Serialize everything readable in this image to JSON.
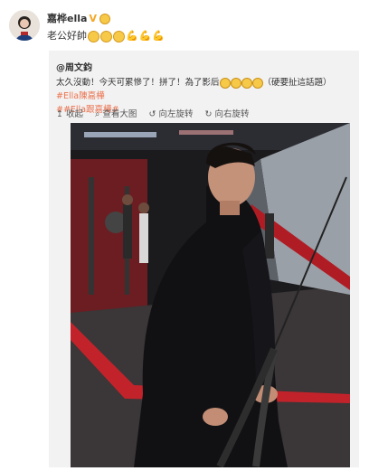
{
  "post": {
    "author": "嘉桦ella",
    "verified_badge": "V",
    "text": "老公好帥"
  },
  "repost": {
    "author": "@周文鈞",
    "text_main": "太久沒動！今天可累慘了！拼了！為了影后",
    "text_tail": "（硬要扯這話題）",
    "hashtag_1": "#Ella陳嘉樺",
    "hashtag_2": "##Ella跟嘉樺#",
    "toolbar": {
      "collect": "收起",
      "view_large": "查看大图",
      "rotate_left": "向左旋转",
      "rotate_right": "向右旋转"
    }
  },
  "colors": {
    "link": "#eb7350",
    "badge": "#f5a623",
    "repost_bg": "#f2f2f2"
  },
  "icons": [
    "avatar",
    "verified-icon",
    "grin-emoji-icon",
    "flexed-arm-icon",
    "collapse-icon",
    "search-icon",
    "rotate-left-icon",
    "rotate-right-icon"
  ]
}
